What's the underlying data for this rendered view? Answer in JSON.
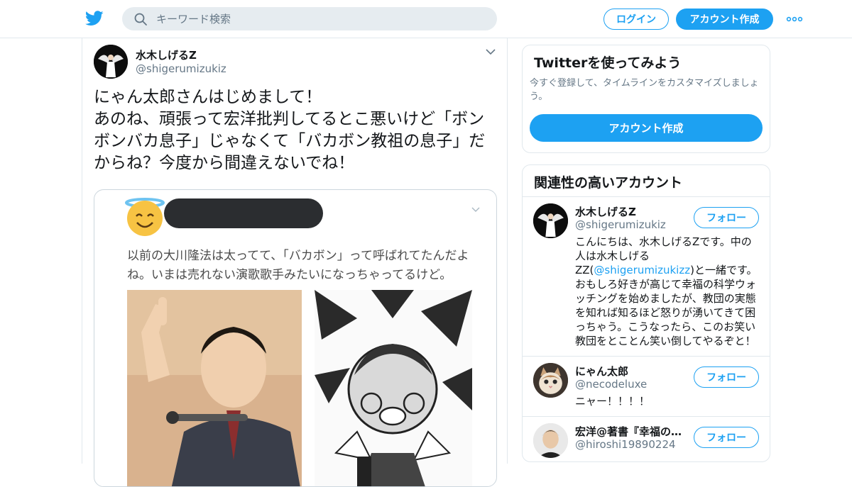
{
  "header": {
    "search_placeholder": "キーワード検索",
    "login_label": "ログイン",
    "signup_label": "アカウント作成"
  },
  "tweet": {
    "author_name": "水木しげるZ",
    "author_handle": "@shigerumizukiz",
    "text": "にゃん太郎さんはじめまして！\nあのね、頑張って宏洋批判してるとこ悪いけど「ボンボンバカ息子」じゃなくて「バカボン教祖の息子」だからね？今度から間違えないでね！",
    "media": {
      "text": "以前の大川隆法は太ってて、「バカボン」って呼ばれてたんだよね。いまは売れない演歌歌手みたいになっちゃってるけど。"
    }
  },
  "sidebar": {
    "try_card": {
      "title": "Twitterを使ってみよう",
      "description": "今すぐ登録して、タイムラインをカスタマイズしましょう。",
      "cta": "アカウント作成"
    },
    "related": {
      "title": "関連性の高いアカウント",
      "follow_label": "フォロー",
      "accounts": [
        {
          "name": "水木しげるZ",
          "handle": "@shigerumizukiz",
          "bio_before": "こんにちは、水木しげるZです。中の人は水木しげるZZ(",
          "bio_link": "@shigerumizukizz",
          "bio_after": ")と一緒です。おもしろ好きが高じて幸福の科学ウォッチングを始めましたが、教団の実態を知れば知るほど怒りが湧いてきて困っちゃう。こうなったら、このお笑い教団をとことん笑い倒してやるぞと！"
        },
        {
          "name": "にゃん太郎",
          "handle": "@necodeluxe",
          "bio": "ニャー！！！！"
        },
        {
          "name": "宏洋@著書『幸福の科学との訣別』",
          "handle": "@hiroshi19890224"
        }
      ]
    }
  },
  "colors": {
    "brand": "#1da1f2",
    "text": "#14171a",
    "muted": "#657786",
    "border": "#e1e8ed"
  },
  "icons": [
    "twitter-bird-icon",
    "search-icon",
    "more-dots-icon",
    "chevron-down-icon"
  ]
}
